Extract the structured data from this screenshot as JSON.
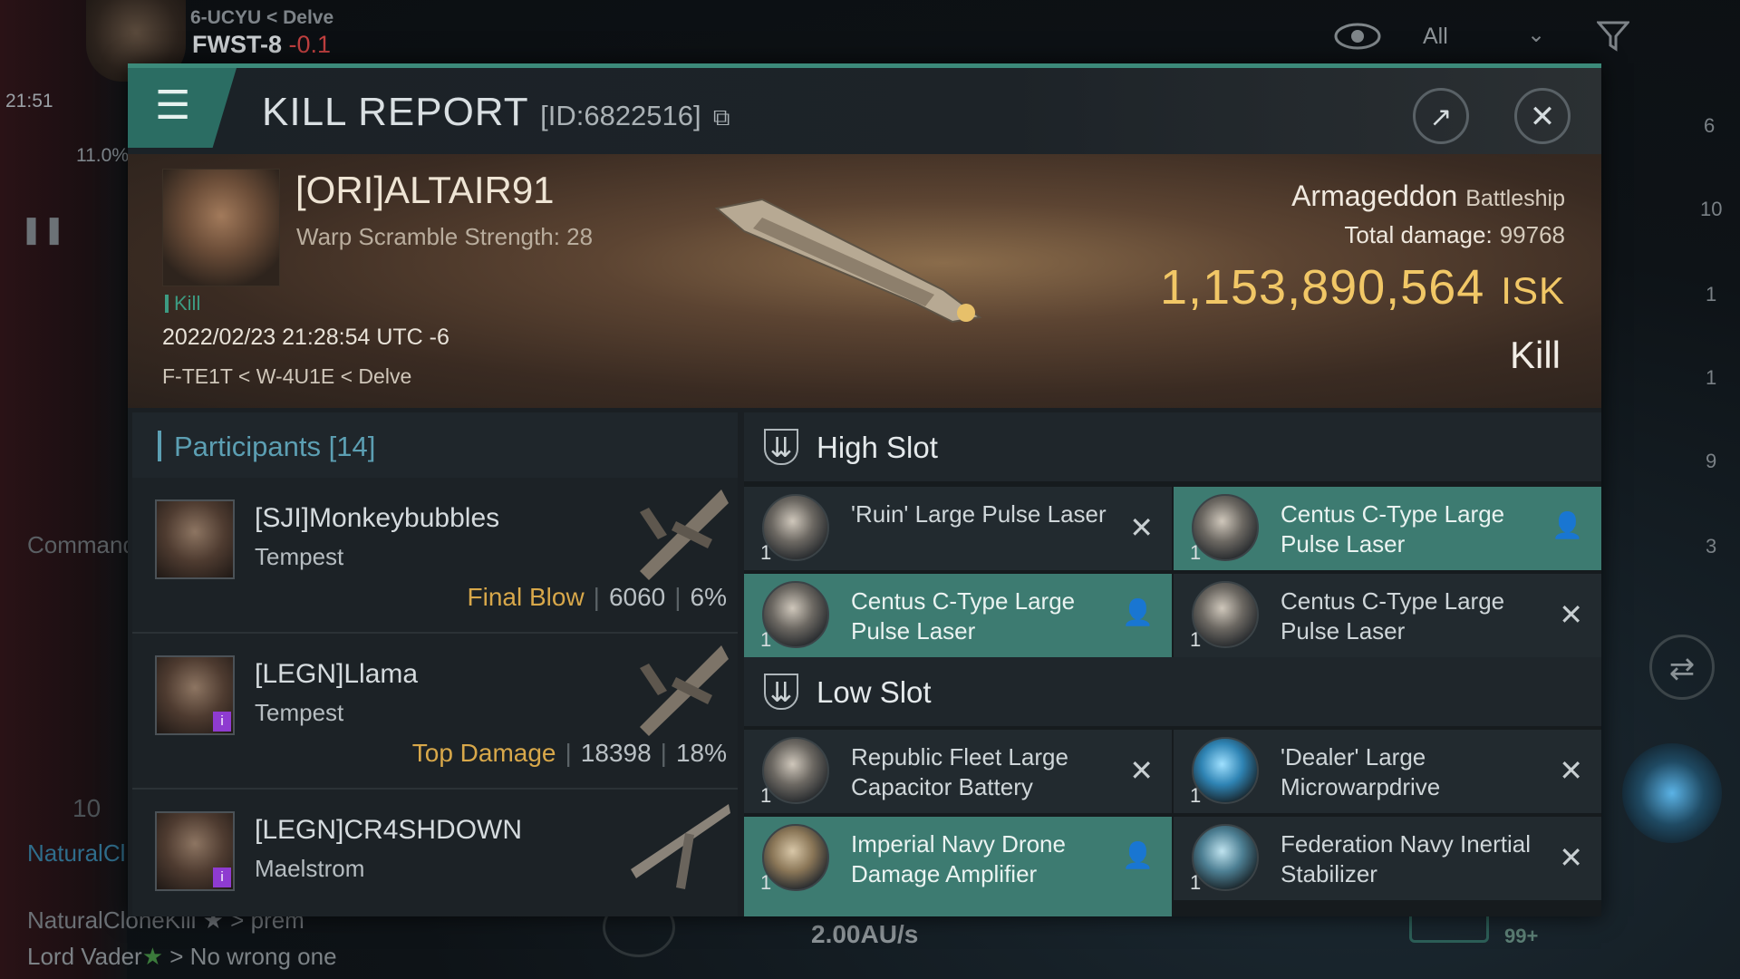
{
  "background": {
    "system_region": "6-UCYU < Delve",
    "system_name": "FWST-8",
    "security": "-0.1",
    "clock": "21:51",
    "cargo_percent": "11.0%",
    "view_filter": "All",
    "right_counts": [
      "6",
      "10",
      "1",
      "1",
      "9",
      "3"
    ],
    "command_label": "Command",
    "chat_line_1": "NaturalCloneKill ★ > prem",
    "chat_line_2_name": "Lord Vader",
    "chat_line_2_text": " > No wrong one",
    "speed": "2.00AU/s",
    "notif_badge": "99+",
    "left_count": "10",
    "natural_label": "NaturalCl"
  },
  "window": {
    "title": "KILL REPORT",
    "report_id": "[ID:6822516]",
    "accent_color": "#3c8a7a"
  },
  "victim": {
    "name": "[ORI]ALTAIR91",
    "warp_scramble": "Warp Scramble Strength: 28",
    "tag": "Kill",
    "datetime": "2022/02/23 21:28:54 UTC -6",
    "location": "F-TE1T < W-4U1E < Delve",
    "ship": "Armageddon",
    "ship_class": "Battleship",
    "total_damage_label": "Total damage:",
    "total_damage": "99768",
    "isk_value": "1,153,890,564",
    "isk_unit": "ISK",
    "result": "Kill"
  },
  "participants": {
    "label": "Participants",
    "count": "[14]",
    "rows": [
      {
        "name": "[SJI]Monkeybubbles",
        "ship": "Tempest",
        "tag": "Final Blow",
        "damage": "6060",
        "percent": "6%"
      },
      {
        "name": "[LEGN]Llama",
        "ship": "Tempest",
        "tag": "Top Damage",
        "damage": "18398",
        "percent": "18%"
      },
      {
        "name": "[LEGN]CR4SHDOWN",
        "ship": "Maelstrom",
        "tag": "",
        "damage": "",
        "percent": ""
      }
    ]
  },
  "high_slot": {
    "title": "High Slot",
    "modules": [
      {
        "name": "'Ruin' Large Pulse Laser",
        "qty": "1",
        "status": "destroyed"
      },
      {
        "name": "Centus C-Type Large Pulse Laser",
        "qty": "1",
        "status": "dropped"
      },
      {
        "name": "Centus C-Type Large Pulse Laser",
        "qty": "1",
        "status": "dropped"
      },
      {
        "name": "Centus C-Type Large Pulse Laser",
        "qty": "1",
        "status": "destroyed"
      }
    ]
  },
  "low_slot": {
    "title": "Low Slot",
    "modules": [
      {
        "name": "Republic Fleet Large Capacitor Battery",
        "qty": "1",
        "status": "destroyed"
      },
      {
        "name": "'Dealer' Large Microwarpdrive",
        "qty": "1",
        "status": "destroyed"
      },
      {
        "name": "Imperial Navy Drone Damage Amplifier",
        "qty": "1",
        "status": "dropped"
      },
      {
        "name": "Federation Navy Inertial Stabilizer",
        "qty": "1",
        "status": "destroyed"
      }
    ]
  }
}
